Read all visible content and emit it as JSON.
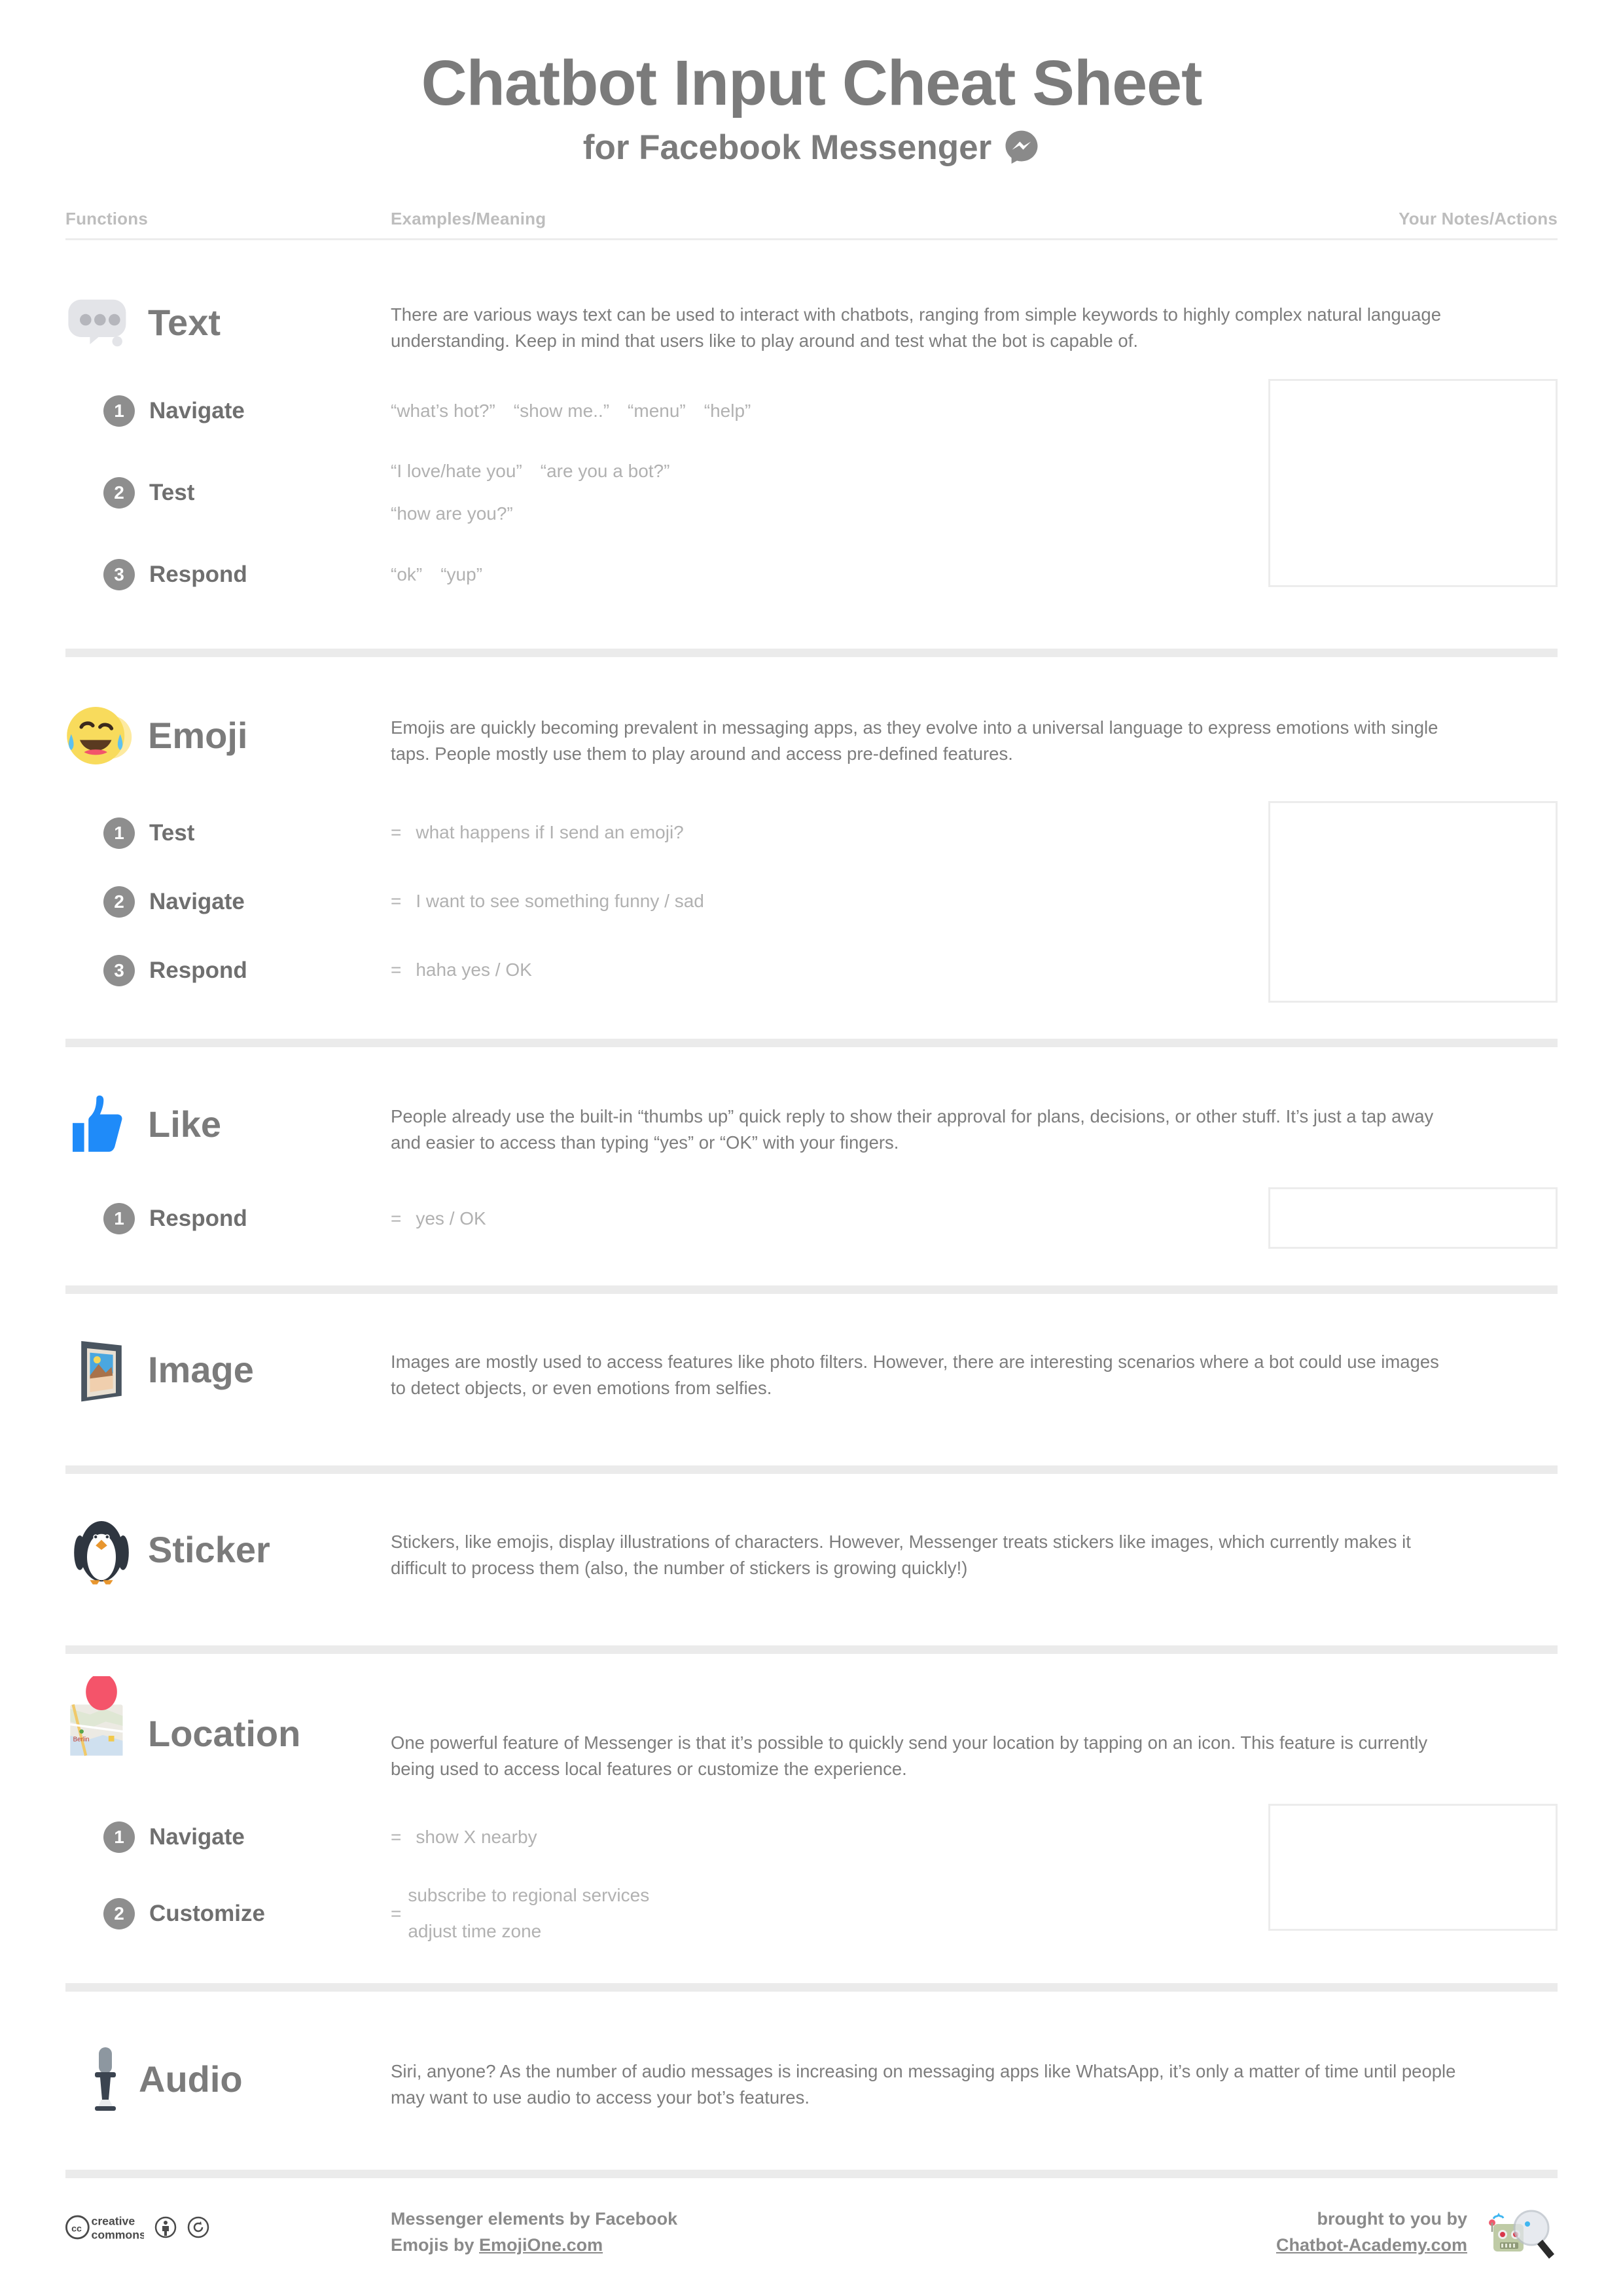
{
  "header": {
    "title": "Chatbot Input Cheat Sheet",
    "subtitle": "for Facebook Messenger",
    "messenger_icon": "messenger-logo-icon"
  },
  "columns": {
    "functions": "Functions",
    "examples": "Examples/Meaning",
    "notes": "Your Notes/Actions"
  },
  "colors": {
    "title_gray": "#7b7b7b",
    "body_gray": "#7d7d7d",
    "muted_gray": "#b1b1b1",
    "bar_gray": "#ebebeb",
    "border_gray": "#ececec",
    "badge_gray": "#8e8e8e",
    "like_blue": "#1f8bf9",
    "emoji_yellow": "#fadb5f",
    "pin_red": "#f4546a"
  },
  "sections": [
    {
      "id": "text",
      "title": "Text",
      "icon": "chat-bubble-dots-icon",
      "description": "There are various ways text can be used to interact with chatbots, ranging from simple keywords to highly complex natural language understanding. Keep in mind that users like to play around and test what the bot is capable of.",
      "has_notes": true,
      "rows": [
        {
          "num": "1",
          "label": "Navigate",
          "examples": [
            "“what’s hot?”",
            "“show me..”",
            "“menu”",
            "“help”"
          ]
        },
        {
          "num": "2",
          "label": "Test",
          "examples": [
            "“I love/hate you”",
            "“are you a bot?”"
          ],
          "examples_line2": [
            "“how are you?”"
          ]
        },
        {
          "num": "3",
          "label": "Respond",
          "examples": [
            "“ok”",
            "“yup”"
          ]
        }
      ]
    },
    {
      "id": "emoji",
      "title": "Emoji",
      "icon": "face-with-tears-of-joy-icon",
      "description": "Emojis are quickly becoming prevalent in messaging apps, as they evolve into a universal language to express emotions with single taps. People mostly use them to play around and access pre-defined features.",
      "has_notes": true,
      "rows": [
        {
          "num": "1",
          "label": "Test",
          "eq": "=",
          "examples": [
            "what happens if I send an emoji?"
          ]
        },
        {
          "num": "2",
          "label": "Navigate",
          "eq": "=",
          "examples": [
            "I want to see something funny / sad"
          ]
        },
        {
          "num": "3",
          "label": "Respond",
          "eq": "=",
          "examples": [
            "haha  yes / OK"
          ]
        }
      ]
    },
    {
      "id": "like",
      "title": "Like",
      "icon": "thumbs-up-icon",
      "description": "People already use the built-in “thumbs up” quick reply to show their approval for plans, decisions, or other stuff. It’s just a tap away and easier to access than typing “yes” or “OK” with your fingers.",
      "has_notes": true,
      "rows": [
        {
          "num": "1",
          "label": "Respond",
          "eq": "=",
          "examples": [
            "yes / OK"
          ]
        }
      ]
    },
    {
      "id": "image",
      "title": "Image",
      "icon": "framed-picture-icon",
      "description": "Images are mostly used to access features like photo filters. However, there are interesting scenarios where a bot could use images to detect objects, or even emotions from selfies.",
      "has_notes": false,
      "rows": []
    },
    {
      "id": "sticker",
      "title": "Sticker",
      "icon": "penguin-icon",
      "description": "Stickers, like emojis, display illustrations of characters. However, Messenger treats stickers like images, which currently makes it difficult to process them (also, the number of stickers is growing quickly!)",
      "has_notes": false,
      "rows": []
    },
    {
      "id": "location",
      "title": "Location",
      "icon": "map-with-pin-icon",
      "description": "One powerful feature of Messenger is that it’s possible to quickly send your location by tapping on an icon. This feature is currently being used to access local features or customize the experience.",
      "has_notes": true,
      "rows": [
        {
          "num": "1",
          "label": "Navigate",
          "eq": "=",
          "examples": [
            "show X nearby"
          ]
        },
        {
          "num": "2",
          "label": "Customize",
          "eq": "=",
          "multi": [
            "subscribe to regional services",
            "adjust time zone"
          ]
        }
      ]
    },
    {
      "id": "audio",
      "title": "Audio",
      "icon": "microphone-icon",
      "description": "Siri, anyone? As the number of audio messages is increasing on messaging apps like WhatsApp, it’s only a matter of time until people may want to use audio to access your bot’s features.",
      "has_notes": false,
      "rows": []
    }
  ],
  "footer": {
    "cc_line1": "creative",
    "cc_line2": "commons",
    "cc_icon": "creative-commons-icon",
    "cc_by_icon": "cc-by-icon",
    "cc_sa_icon": "cc-share-alike-icon",
    "credit_line1": "Messenger elements by Facebook",
    "credit_line2_prefix": "Emojis by ",
    "credit_line2_link": "EmojiOne.com",
    "brought_by": "brought to you by",
    "brand_link": "Chatbot-Academy.com",
    "brand_icon": "robot-magnifier-icon"
  }
}
